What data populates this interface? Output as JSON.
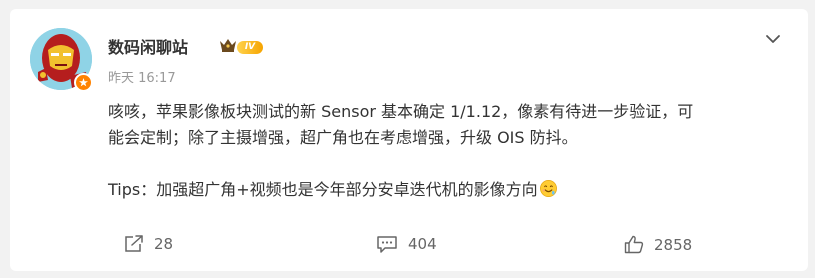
{
  "post": {
    "author": {
      "name": "数码闲聊站",
      "level_badge": "IV"
    },
    "meta": {
      "time": "昨天 16:17"
    },
    "content": {
      "line1": "咳咳，苹果影像板块测试的新 Sensor 基本确定 1/1.12，像素有待进一步验证，可",
      "line2": "能会定制；除了主摄增强，超广角也在考虑增强，升级 OIS 防抖。",
      "line3": "Tips：加强超广角+视频也是今年部分安卓迭代机的影像方向"
    },
    "actions": {
      "repost_count": "28",
      "comment_count": "404",
      "like_count": "2858"
    }
  },
  "icons": {
    "menu": "chevron-down-icon",
    "repost": "repost-icon",
    "comment": "comment-icon",
    "like": "thumbs-up-icon",
    "vip": "crown-icon",
    "verified": "verified-badge-icon",
    "emoji": "drooling-face-emoji"
  },
  "colors": {
    "accent_orange": "#ff8200",
    "text_primary": "#333333",
    "text_secondary": "#999999",
    "icon_gray": "#666666"
  }
}
